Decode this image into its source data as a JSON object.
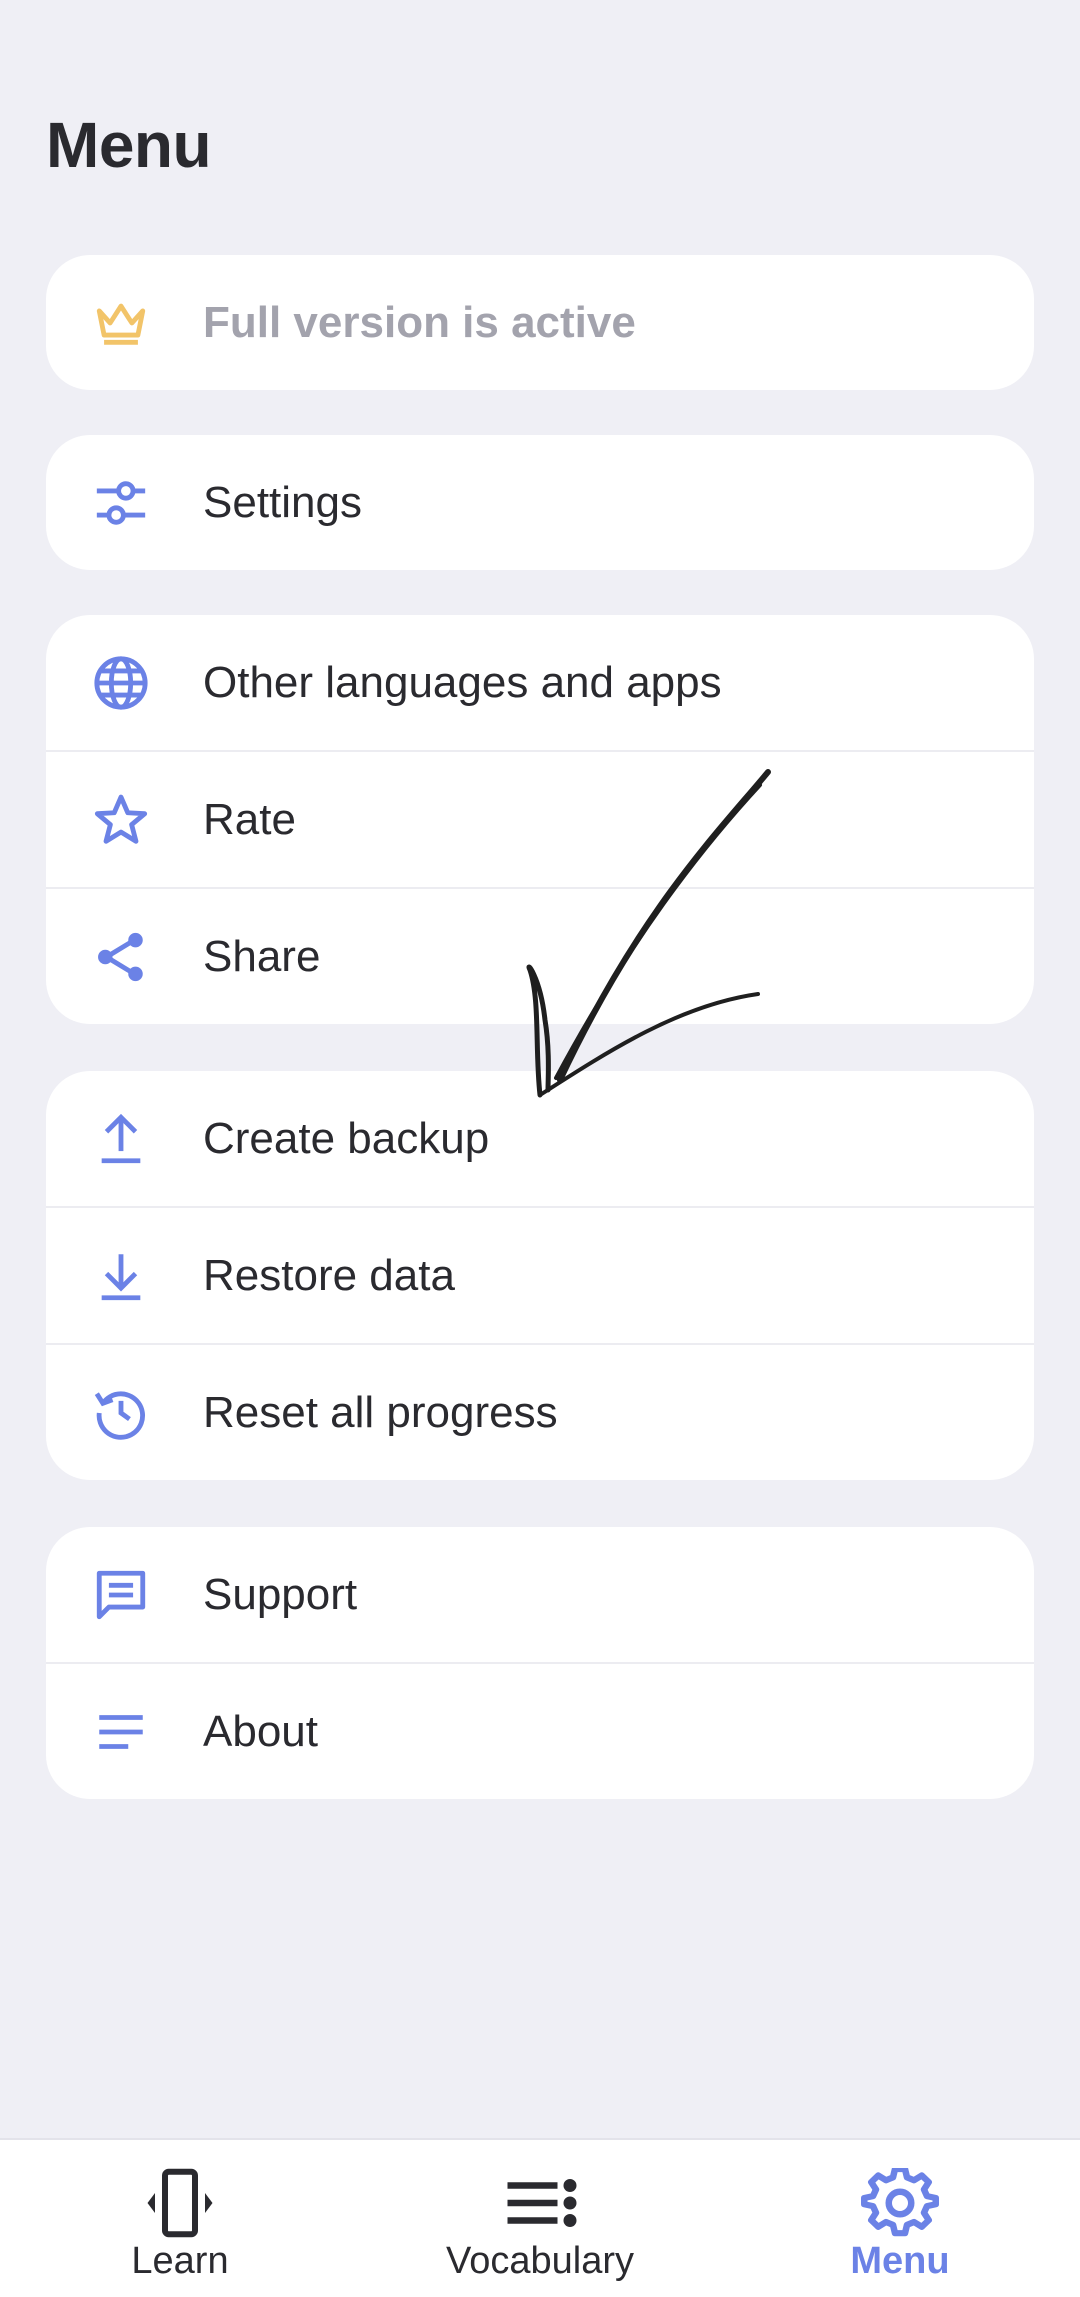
{
  "header": {
    "title": "Menu"
  },
  "colors": {
    "accent": "#6b82e6",
    "crown": "#f2c469",
    "background": "#efeff5"
  },
  "groups": [
    {
      "items": [
        {
          "icon": "crown-icon",
          "label": "Full version is active",
          "muted": true
        }
      ]
    },
    {
      "items": [
        {
          "icon": "sliders-icon",
          "label": "Settings"
        }
      ]
    },
    {
      "items": [
        {
          "icon": "globe-icon",
          "label": "Other languages and apps"
        },
        {
          "icon": "star-icon",
          "label": "Rate"
        },
        {
          "icon": "share-icon",
          "label": "Share"
        }
      ]
    },
    {
      "items": [
        {
          "icon": "upload-icon",
          "label": "Create backup"
        },
        {
          "icon": "download-icon",
          "label": "Restore data"
        },
        {
          "icon": "history-icon",
          "label": "Reset all progress"
        }
      ]
    },
    {
      "items": [
        {
          "icon": "chat-icon",
          "label": "Support"
        },
        {
          "icon": "lines-icon",
          "label": "About"
        }
      ]
    }
  ],
  "tabs": [
    {
      "icon": "phone-swipe-icon",
      "label": "Learn",
      "active": false
    },
    {
      "icon": "list-icon",
      "label": "Vocabulary",
      "active": false
    },
    {
      "icon": "gear-icon",
      "label": "Menu",
      "active": true
    }
  ]
}
